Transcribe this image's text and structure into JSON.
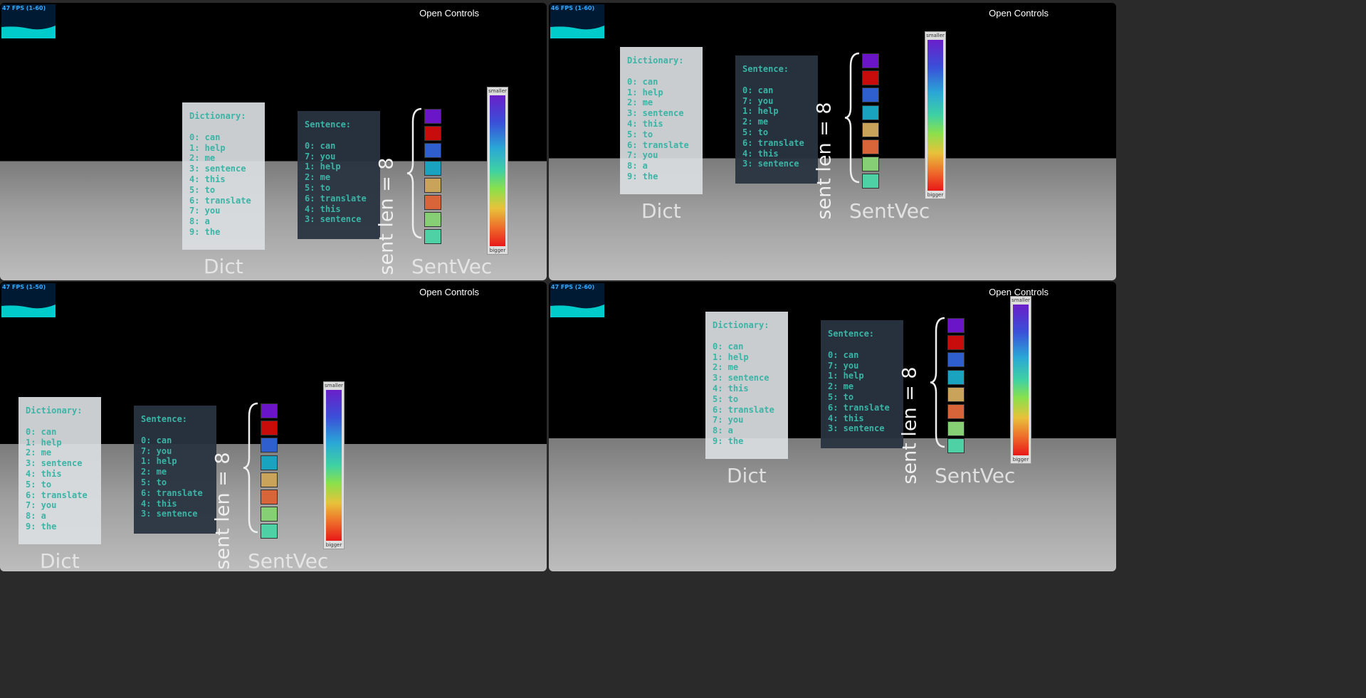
{
  "controls_label": "Open Controls",
  "fps_labels": [
    "47 FPS (1-60)",
    "46 FPS (1-60)",
    "47 FPS (1-50)",
    "47 FPS (2-60)"
  ],
  "dict": {
    "title": "Dictionary:",
    "items": [
      "0: can",
      "1: help",
      "2: me",
      "3: sentence",
      "4: this",
      "5: to",
      "6: translate",
      "7: you",
      "8: a",
      "9: the"
    ]
  },
  "sentence": {
    "title": "Sentence:",
    "items": [
      "0: can",
      "7: you",
      "1: help",
      "2: me",
      "5: to",
      "6: translate",
      "4: this",
      "3: sentence"
    ]
  },
  "labels": {
    "dict": "Dict",
    "sentvec": "SentVec",
    "sent_len": "sent len = 8"
  },
  "colorbar": {
    "top": "smaller",
    "bottom": "bigger"
  },
  "vector_colors": [
    "#6a16c8",
    "#c80c0c",
    "#2f5fcf",
    "#1aa3bf",
    "#c9a35a",
    "#d8653a",
    "#86cf74",
    "#4fd1a6"
  ],
  "colors": {
    "panel_text": "#3bb4a6",
    "fps_text": "#33aaff"
  }
}
